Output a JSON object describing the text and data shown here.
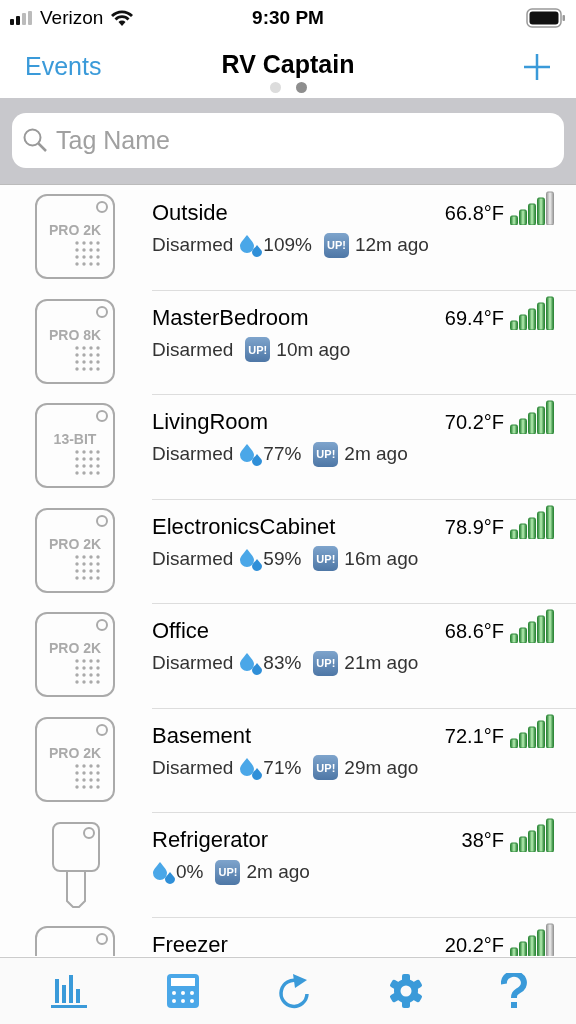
{
  "status_bar": {
    "carrier": "Verizon",
    "time": "9:30 PM"
  },
  "nav": {
    "left": "Events",
    "title": "RV Captain",
    "pages": [
      {
        "selected": false
      },
      {
        "selected": true
      }
    ]
  },
  "search": {
    "placeholder": "Tag Name"
  },
  "tags": [
    {
      "name": "Outside",
      "temperature": "66.8°F",
      "signal_weak": true,
      "tag": {
        "kind": "square",
        "label": "PRO 2K"
      },
      "status": "Disarmed",
      "humidity": "109%",
      "badge": "UP!",
      "updated": "12m ago"
    },
    {
      "name": "MasterBedroom",
      "temperature": "69.4°F",
      "signal_weak": false,
      "tag": {
        "kind": "square",
        "label": "PRO 8K"
      },
      "status": "Disarmed",
      "badge": "UP!",
      "updated": "10m ago"
    },
    {
      "name": "LivingRoom",
      "temperature": "70.2°F",
      "signal_weak": false,
      "tag": {
        "kind": "square",
        "label": "13-BIT"
      },
      "status": "Disarmed",
      "humidity": "77%",
      "badge": "UP!",
      "updated": "2m ago"
    },
    {
      "name": "ElectronicsCabinet",
      "temperature": "78.9°F",
      "signal_weak": false,
      "tag": {
        "kind": "square",
        "label": "PRO 2K"
      },
      "status": "Disarmed",
      "humidity": "59%",
      "badge": "UP!",
      "updated": "16m ago"
    },
    {
      "name": "Office",
      "temperature": "68.6°F",
      "signal_weak": false,
      "tag": {
        "kind": "square",
        "label": "PRO 2K"
      },
      "status": "Disarmed",
      "humidity": "83%",
      "badge": "UP!",
      "updated": "21m ago"
    },
    {
      "name": "Basement",
      "temperature": "72.1°F",
      "signal_weak": false,
      "tag": {
        "kind": "square",
        "label": "PRO 2K"
      },
      "status": "Disarmed",
      "humidity": "71%",
      "badge": "UP!",
      "updated": "29m ago"
    },
    {
      "name": "Refrigerator",
      "temperature": "38°F",
      "signal_weak": false,
      "tag": {
        "kind": "key"
      },
      "humidity": "0%",
      "badge": "UP!",
      "updated": "2m ago"
    },
    {
      "name": "Freezer",
      "temperature": "20.2°F",
      "signal_weak": true,
      "tag": {
        "kind": "square"
      }
    }
  ],
  "tab_bar": [
    {
      "kind": "chart"
    },
    {
      "kind": "calculator"
    },
    {
      "kind": "refresh"
    },
    {
      "kind": "settings"
    },
    {
      "kind": "help"
    }
  ]
}
